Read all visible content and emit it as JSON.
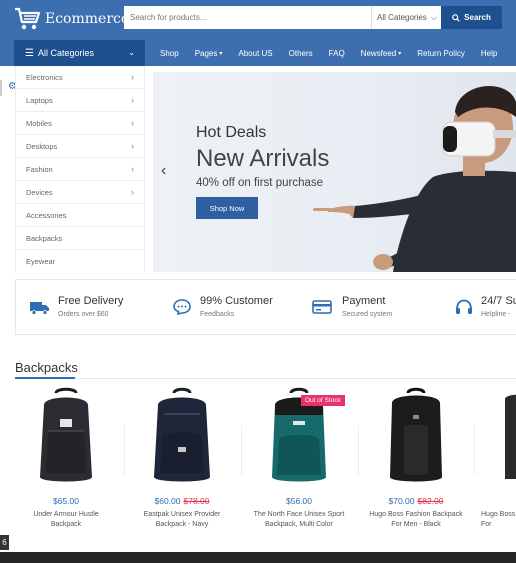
{
  "header": {
    "logo_text": "Ecommerce",
    "search_placeholder": "Search for products...",
    "category_select": "All Categories",
    "search_button": "Search"
  },
  "nav": {
    "all_categories": "All Categories",
    "links": [
      "Shop",
      "Pages",
      "About US",
      "Others",
      "FAQ",
      "Newsfeed",
      "Return Policy",
      "Help"
    ]
  },
  "categories": [
    {
      "label": "Electronics",
      "has_sub": true
    },
    {
      "label": "Laptops",
      "has_sub": true
    },
    {
      "label": "Mobiles",
      "has_sub": true
    },
    {
      "label": "Desktops",
      "has_sub": true
    },
    {
      "label": "Fashion",
      "has_sub": true
    },
    {
      "label": "Devices",
      "has_sub": true
    },
    {
      "label": "Accessories",
      "has_sub": false
    },
    {
      "label": "Backpacks",
      "has_sub": false
    },
    {
      "label": "Eyewear",
      "has_sub": false
    }
  ],
  "hero": {
    "subtitle": "Hot Deals",
    "title": "New Arrivals",
    "offer": "40% off on first purchase",
    "button": "Shop Now"
  },
  "features": [
    {
      "title": "Free Delivery",
      "sub": "Orders over $60",
      "icon": "truck-icon"
    },
    {
      "title": "99% Customer",
      "sub": "Feedbacks",
      "icon": "chat-icon"
    },
    {
      "title": "Payment",
      "sub": "Secured system",
      "icon": "card-icon"
    },
    {
      "title": "24/7 Su",
      "sub": "Helpline -",
      "icon": "headset-icon"
    }
  ],
  "section_title": "Backpacks",
  "products": [
    {
      "price": "$65.00",
      "old_price": "",
      "name1": "Under Armour Hustle",
      "name2": "Backpack",
      "badge": ""
    },
    {
      "price": "$60.00",
      "old_price": "$78.00",
      "name1": "Eastpak Unisex Provider",
      "name2": "Backpack - Navy",
      "badge": ""
    },
    {
      "price": "$56.00",
      "old_price": "",
      "name1": "The North Face Unisex Sport",
      "name2": "Backpack, Multi Color",
      "badge": "Out of Stock"
    },
    {
      "price": "$70.00",
      "old_price": "$82.00",
      "name1": "Hugo Boss Fashion Backpack",
      "name2": "For Men - Black",
      "badge": ""
    },
    {
      "price": "",
      "old_price": "",
      "name1": "Hugo Boss",
      "name2": "For",
      "badge": ""
    }
  ],
  "corner_number": "6",
  "colors": {
    "primary": "#3d6fb0",
    "dark_primary": "#1e4f8f",
    "accent_red": "#e0344a",
    "badge_pink": "#e7326e"
  }
}
